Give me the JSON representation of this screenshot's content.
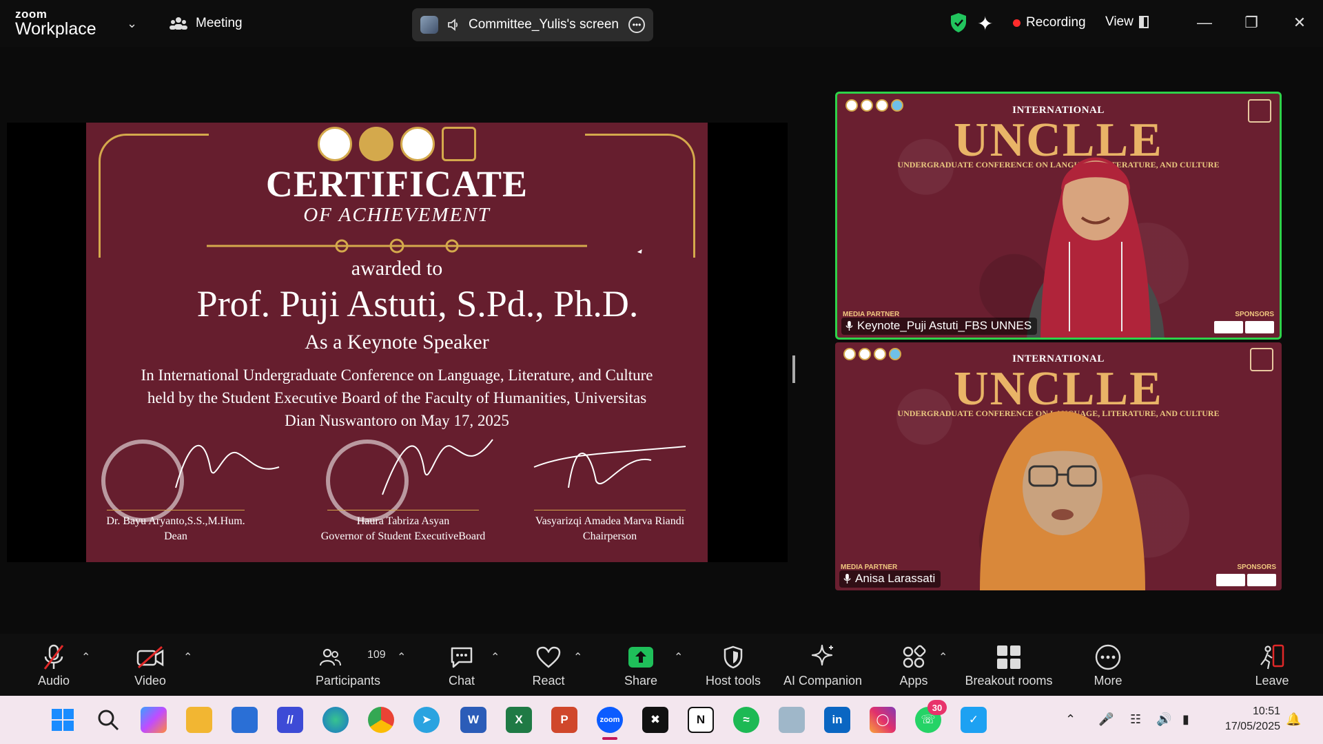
{
  "app": {
    "brand_top": "zoom",
    "brand_bottom": "Workplace",
    "meeting_label": "Meeting"
  },
  "share_bar": {
    "label": "Committee_Yulis's screen"
  },
  "status": {
    "recording_label": "Recording",
    "view_label": "View"
  },
  "colors": {
    "accent_green": "#2ed24a",
    "recording_red": "#ff2b2b",
    "cert_bg": "#661e2e",
    "gold": "#d4a94c",
    "share_green": "#1fbf5a"
  },
  "certificate": {
    "title": "CERTIFICATE",
    "subtitle": "OF ACHIEVEMENT",
    "awarded": "awarded to",
    "recipient": "Prof. Puji Astuti, S.Pd., Ph.D.",
    "role": "As a Keynote Speaker",
    "description": "In International Undergraduate Conference on Language, Literature, and Culture held by the Student Executive Board of the Faculty of Humanities, Universitas Dian Nuswantoro on May 17, 2025",
    "signatories": [
      {
        "name": "Dr. Bayu Aryanto,S.S.,M.Hum.",
        "title": "Dean"
      },
      {
        "name": "Haura Tabriza Asyan",
        "title": "Governor of Student ExecutiveBoard"
      },
      {
        "name": "Vasyarizqi Amadea Marva Riandi",
        "title": "Chairperson"
      }
    ]
  },
  "tiles": [
    {
      "name": "Keynote_Puji Astuti_FBS UNNES",
      "banner_top": "INTERNATIONAL",
      "banner_main": "UNCLLE",
      "banner_line": "UNDERGRADUATE CONFERENCE ON LANGUAGE, LITERATURE, AND CULTURE",
      "media_label": "MEDIA PARTNER",
      "sponsor_label": "SPONSORS"
    },
    {
      "name": "Anisa Larassati",
      "banner_top": "INTERNATIONAL",
      "banner_main": "UNCLLE",
      "banner_line": "UNDERGRADUATE CONFERENCE ON LANGUAGE, LITERATURE, AND CULTURE",
      "media_label": "MEDIA PARTNER",
      "sponsor_label": "SPONSORS"
    }
  ],
  "toolbar": {
    "audio": "Audio",
    "video": "Video",
    "participants": "Participants",
    "participants_count": "109",
    "chat": "Chat",
    "react": "React",
    "share": "Share",
    "host_tools": "Host tools",
    "ai_companion": "AI Companion",
    "apps": "Apps",
    "breakout": "Breakout rooms",
    "more": "More",
    "leave": "Leave"
  },
  "taskbar": {
    "whatsapp_badge": "30",
    "time": "10:51",
    "date": "17/05/2025",
    "icons": [
      "windows-start-icon",
      "search-icon",
      "copilot-icon",
      "file-explorer-icon",
      "microsoft-store-icon",
      "visual-studio-icon",
      "edge-icon",
      "chrome-icon",
      "telegram-icon",
      "word-icon",
      "excel-icon",
      "powerpoint-icon",
      "zoom-icon",
      "capcut-icon",
      "notion-icon",
      "spotify-icon",
      "building-app-icon",
      "linkedin-icon",
      "instagram-icon",
      "whatsapp-icon",
      "twitter-icon"
    ]
  }
}
